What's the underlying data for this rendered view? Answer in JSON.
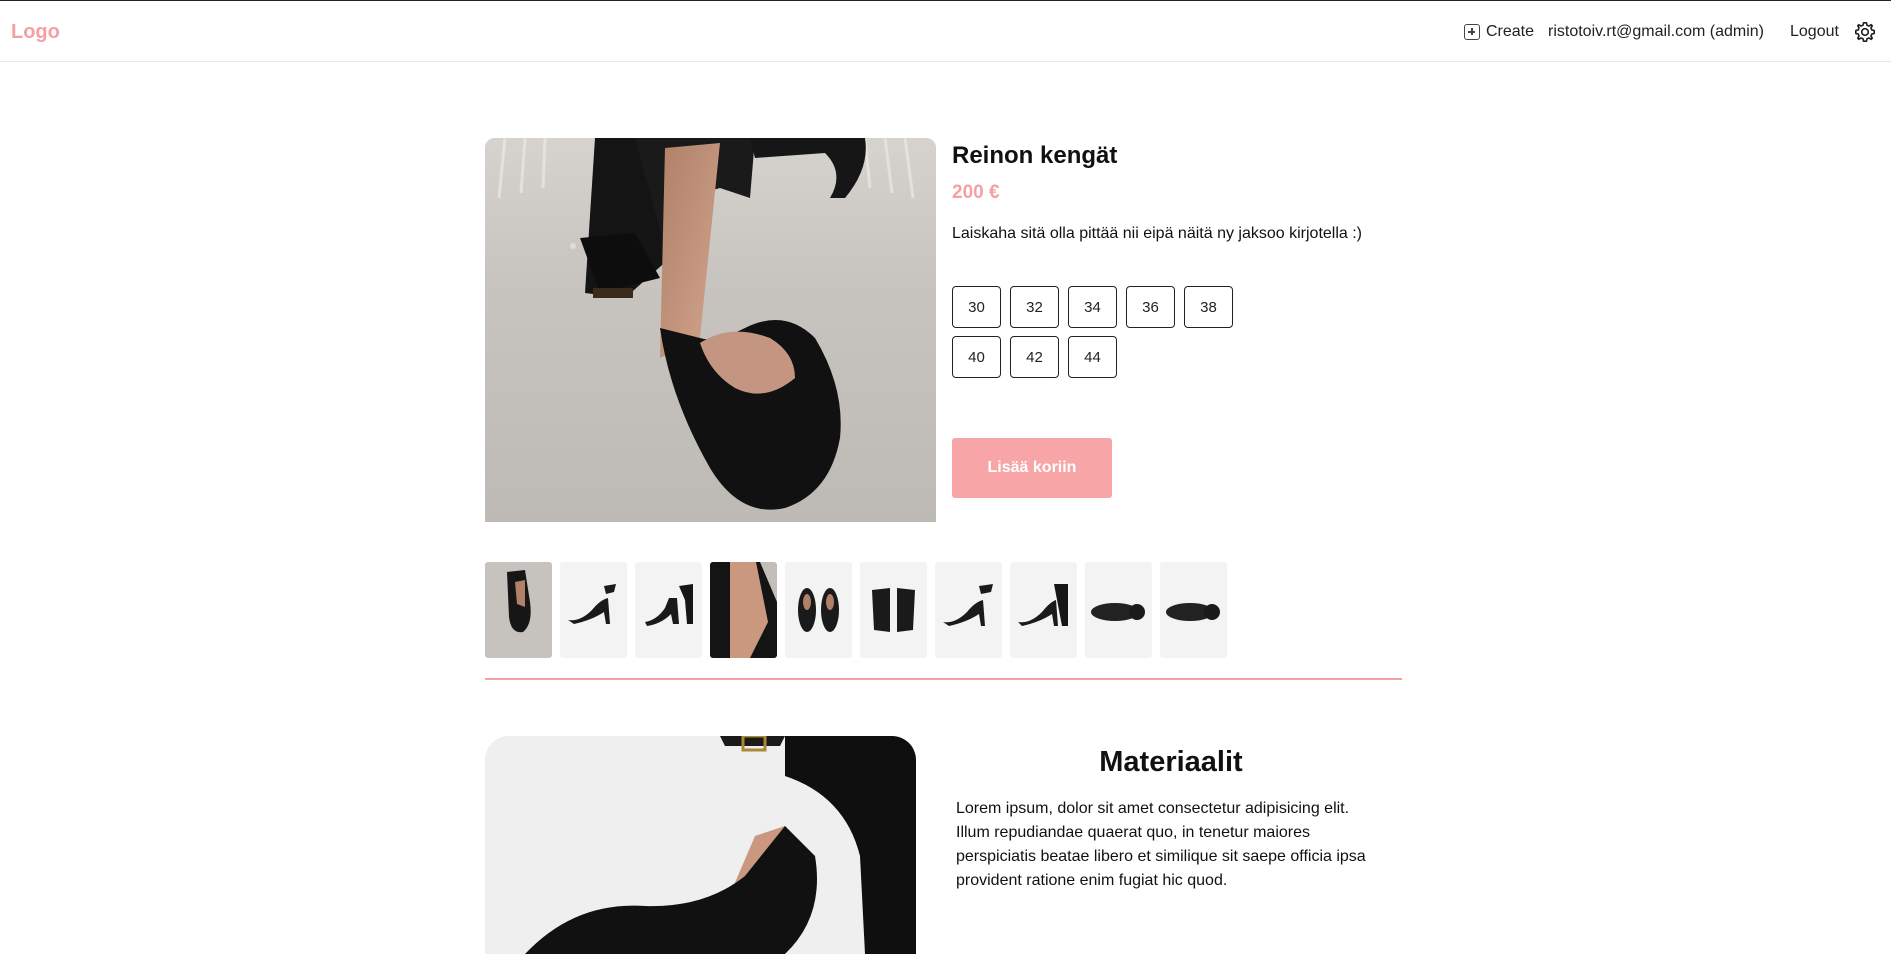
{
  "header": {
    "logo": "Logo",
    "create_label": "Create",
    "user_label": "ristotoiv.rt@gmail.com (admin)",
    "logout_label": "Logout"
  },
  "product": {
    "title": "Reinon kengät",
    "price": "200 €",
    "description": "Laiskaha sitä olla pittää nii eipä näitä ny jaksoo kirjotella :)",
    "sizes": [
      "30",
      "32",
      "34",
      "36",
      "38",
      "40",
      "42",
      "44"
    ],
    "add_to_cart_label": "Lisää koriin",
    "thumbnail_count": 10
  },
  "materials": {
    "title": "Materiaalit",
    "text": "Lorem ipsum, dolor sit amet consectetur adipisicing elit. Illum repudiandae quaerat quo, in tenetur maiores perspiciatis beatae libero et similique sit saepe officia ipsa provident ratione enim fugiat hic quod."
  },
  "colors": {
    "accent": "#f4a0a4",
    "button": "#f8a5a7"
  },
  "icons": {
    "create": "plus-square-icon",
    "settings": "gear-icon"
  }
}
